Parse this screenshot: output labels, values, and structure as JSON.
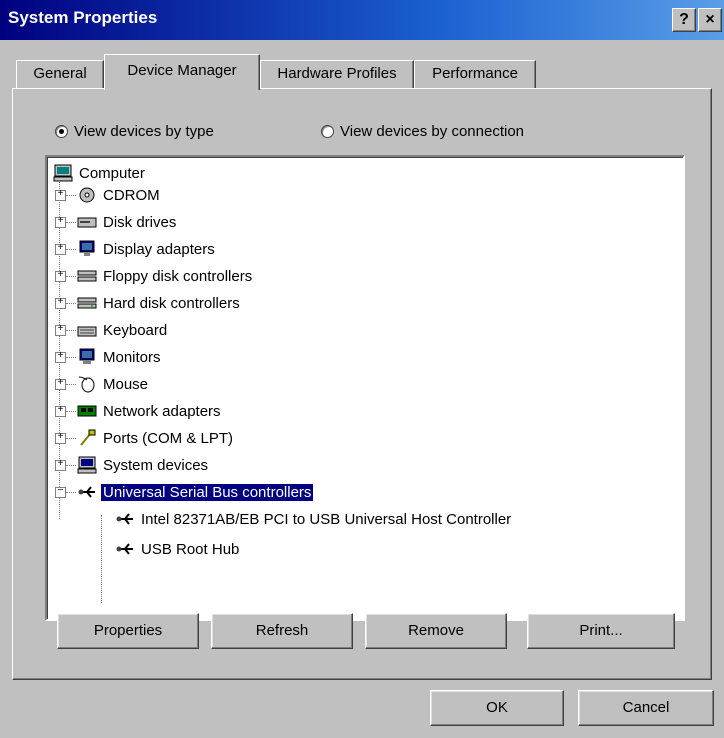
{
  "window": {
    "title": "System Properties"
  },
  "titlebar": {
    "help": "?",
    "close": "×"
  },
  "tabs": [
    "General",
    "Device Manager",
    "Hardware Profiles",
    "Performance"
  ],
  "view_options": {
    "by_type": "View devices by type",
    "by_connection": "View devices by connection",
    "selected": "by_type"
  },
  "tree": {
    "root": "Computer",
    "items": [
      {
        "label": "CDROM",
        "icon": "cdrom-icon"
      },
      {
        "label": "Disk drives",
        "icon": "disk-drive-icon"
      },
      {
        "label": "Display adapters",
        "icon": "display-adapter-icon"
      },
      {
        "label": "Floppy disk controllers",
        "icon": "floppy-controller-icon"
      },
      {
        "label": "Hard disk controllers",
        "icon": "hard-disk-controller-icon"
      },
      {
        "label": "Keyboard",
        "icon": "keyboard-icon"
      },
      {
        "label": "Monitors",
        "icon": "monitor-icon"
      },
      {
        "label": "Mouse",
        "icon": "mouse-icon"
      },
      {
        "label": "Network adapters",
        "icon": "network-adapter-icon"
      },
      {
        "label": "Ports (COM & LPT)",
        "icon": "port-icon"
      },
      {
        "label": "System devices",
        "icon": "system-device-icon"
      },
      {
        "label": "Universal Serial Bus controllers",
        "icon": "usb-icon",
        "expanded": true,
        "selected": true
      }
    ],
    "usb_children": [
      "Intel 82371AB/EB PCI to USB Universal Host Controller",
      "USB Root Hub"
    ]
  },
  "buttons": {
    "properties": "Properties",
    "refresh": "Refresh",
    "remove": "Remove",
    "print": "Print..."
  },
  "dialog_buttons": {
    "ok": "OK",
    "cancel": "Cancel"
  }
}
